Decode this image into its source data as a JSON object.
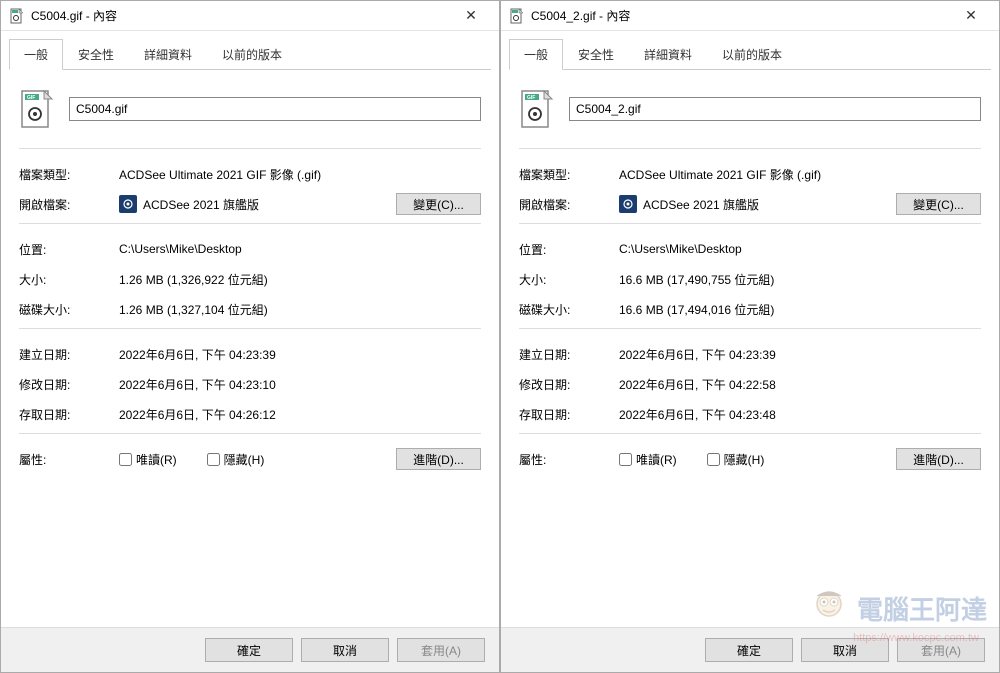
{
  "dialogs": [
    {
      "title": "C5004.gif - 內容",
      "filename": "C5004.gif",
      "tabs": [
        "一般",
        "安全性",
        "詳細資料",
        "以前的版本"
      ],
      "fileType": "ACDSee Ultimate 2021 GIF 影像 (.gif)",
      "openWith": "ACDSee 2021 旗艦版",
      "location": "C:\\Users\\Mike\\Desktop",
      "size": "1.26 MB (1,326,922 位元組)",
      "sizeOnDisk": "1.26 MB (1,327,104 位元組)",
      "created": "2022年6月6日, 下午 04:23:39",
      "modified": "2022年6月6日, 下午 04:23:10",
      "accessed": "2022年6月6日, 下午 04:26:12"
    },
    {
      "title": "C5004_2.gif - 內容",
      "filename": "C5004_2.gif",
      "tabs": [
        "一般",
        "安全性",
        "詳細資料",
        "以前的版本"
      ],
      "fileType": "ACDSee Ultimate 2021 GIF 影像 (.gif)",
      "openWith": "ACDSee 2021 旗艦版",
      "location": "C:\\Users\\Mike\\Desktop",
      "size": "16.6 MB (17,490,755 位元組)",
      "sizeOnDisk": "16.6 MB (17,494,016 位元組)",
      "created": "2022年6月6日, 下午 04:23:39",
      "modified": "2022年6月6日, 下午 04:22:58",
      "accessed": "2022年6月6日, 下午 04:23:48"
    }
  ],
  "labels": {
    "fileType": "檔案類型:",
    "openWith": "開啟檔案:",
    "change": "變更(C)...",
    "location": "位置:",
    "size": "大小:",
    "sizeOnDisk": "磁碟大小:",
    "created": "建立日期:",
    "modified": "修改日期:",
    "accessed": "存取日期:",
    "attributes": "屬性:",
    "readonly": "唯讀(R)",
    "hidden": "隱藏(H)",
    "advanced": "進階(D)...",
    "ok": "確定",
    "cancel": "取消",
    "apply": "套用(A)"
  },
  "watermark": {
    "text": "電腦王阿達",
    "url": "https://www.kocpc.com.tw"
  }
}
